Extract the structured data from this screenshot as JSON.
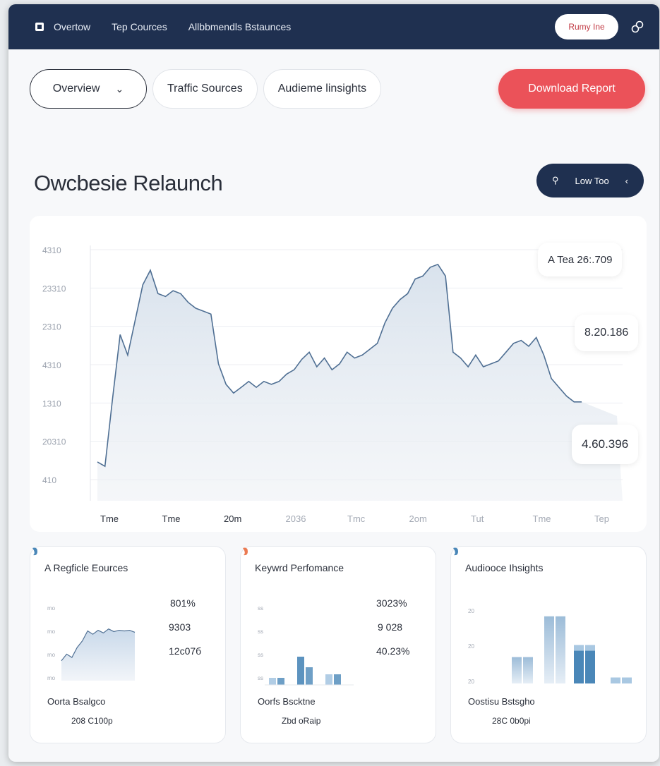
{
  "nav": {
    "items": [
      "Overtow",
      "Tep Cources",
      "Allbbmendls Bstaunces"
    ],
    "pill_label": "Rumy Ine",
    "link_icon": "link-icon"
  },
  "tabs": [
    {
      "label": "Overview",
      "active": true
    },
    {
      "label": "Traffic Sources",
      "active": false
    },
    {
      "label": "Audieme linsights",
      "active": false
    }
  ],
  "download_button": "Download Report",
  "page_title": "Owcbesie Relaunch",
  "filter_button": "Low Too",
  "colors": {
    "navy": "#1f3050",
    "accent_red": "#eb5259",
    "line": "#4f6f93",
    "bar_dark": "#4a87b8",
    "bar_light": "#a9c8e2"
  },
  "chart_data": {
    "type": "area",
    "ytick_labels": [
      "4310",
      "23310",
      "2310",
      "4310",
      "1310",
      "20310",
      "410"
    ],
    "xtick_labels": [
      "Tme",
      "Tme",
      "20m",
      "2036",
      "Tmc",
      "2om",
      "Tut",
      "Tme",
      "Tep"
    ],
    "series": [
      {
        "values": [
          1550,
          1520,
          1980,
          2420,
          2280,
          2520,
          2760,
          2860,
          2700,
          2680,
          2720,
          2700,
          2640,
          2600,
          2580,
          2560,
          2220,
          2080,
          2020,
          2060,
          2100,
          2060,
          2100,
          2080,
          2100,
          2150,
          2180,
          2250,
          2300,
          2200,
          2260,
          2180,
          2220,
          2300,
          2260,
          2280,
          2320,
          2360,
          2500,
          2600,
          2660,
          2700,
          2800,
          2820,
          2880,
          2900,
          2820,
          2300,
          2260,
          2200,
          2280,
          2200,
          2220,
          2240,
          2300,
          2360,
          2380,
          2340,
          2400,
          2280,
          2120,
          2060,
          2000,
          1960,
          1960
        ]
      }
    ],
    "ylim": [
      1400,
      3000
    ],
    "grid": true,
    "annotations": [
      "A  Tea 26:.709",
      "8.20.186",
      "4.60.396"
    ]
  },
  "cards": [
    {
      "title": "A Regficle Eources",
      "stats": [
        "801%",
        "9303",
        "12c07б"
      ],
      "axis_labels": [
        "mo",
        "mo",
        "mo",
        "mo"
      ],
      "kind": "area",
      "mini_values": [
        3,
        4,
        3.5,
        5,
        6,
        7.5,
        7,
        7.6,
        7.2,
        7.8,
        7.4,
        7.6,
        7.5,
        7.6,
        7.3
      ],
      "footer_label": "Oorta Bsalgco",
      "footer_value": "208 C100p"
    },
    {
      "title": "Keywrd Perfomance",
      "stats": [
        "3023%",
        "9 028",
        "40.23%"
      ],
      "axis_labels": [
        "ss",
        "ss",
        "ss",
        "ss"
      ],
      "kind": "bars",
      "bar_values": [
        [
          1,
          1
        ],
        [
          4,
          2.5
        ],
        [
          1.5,
          1.5
        ]
      ],
      "footer_label": "Oorfs Bscktne",
      "footer_value": "Zbd oRaip"
    },
    {
      "title": "Audiooce Ihsights",
      "stats": [],
      "axis_labels": [
        "20",
        "20",
        "20"
      ],
      "kind": "bars",
      "bar_values": [
        [
          2.2,
          2.2
        ],
        [
          5.6,
          5.6
        ],
        [
          3.2,
          3.2
        ],
        [
          0.5,
          0.5
        ]
      ],
      "footer_label": "Oostisu Bstsgho",
      "footer_value": "28C 0b0pi"
    }
  ]
}
